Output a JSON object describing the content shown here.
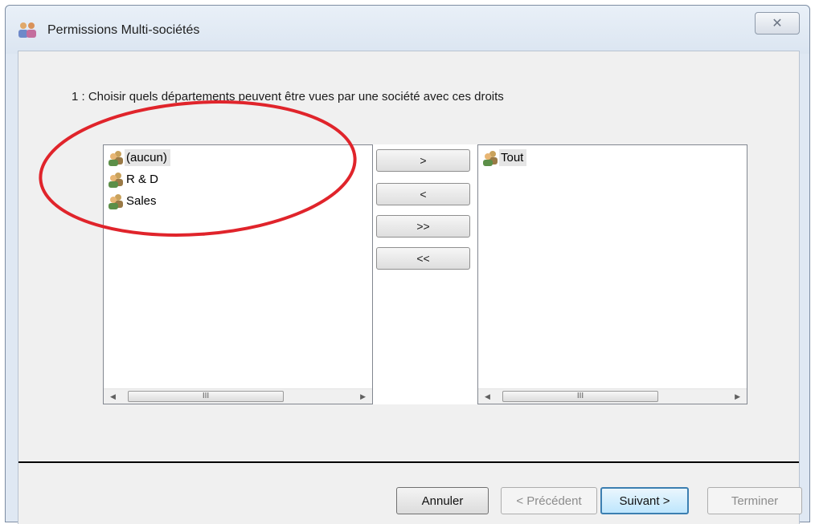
{
  "window": {
    "title": "Permissions Multi-sociétés",
    "close_glyph": "✕"
  },
  "instruction": "1 : Choisir quels départements peuvent être vues par une société avec ces droits",
  "left_list": {
    "items": [
      {
        "label": "(aucun)",
        "icon": "group-icon"
      },
      {
        "label": "R & D",
        "icon": "group-icon"
      },
      {
        "label": "Sales",
        "icon": "group-icon"
      }
    ]
  },
  "right_list": {
    "items": [
      {
        "label": "Tout",
        "icon": "group-icon"
      }
    ]
  },
  "scrollbar": {
    "left_arrow": "◀",
    "right_arrow": "▶",
    "thumb_grip": "III"
  },
  "move_buttons": {
    "add": ">",
    "remove": "<",
    "add_all": ">>",
    "remove_all": "<<"
  },
  "footer": {
    "cancel": "Annuler",
    "previous": "< Précédent",
    "next": "Suivant >",
    "finish": "Terminer"
  },
  "colors": {
    "annotation": "#e0242b",
    "default_button_border": "#3c7fb1"
  }
}
